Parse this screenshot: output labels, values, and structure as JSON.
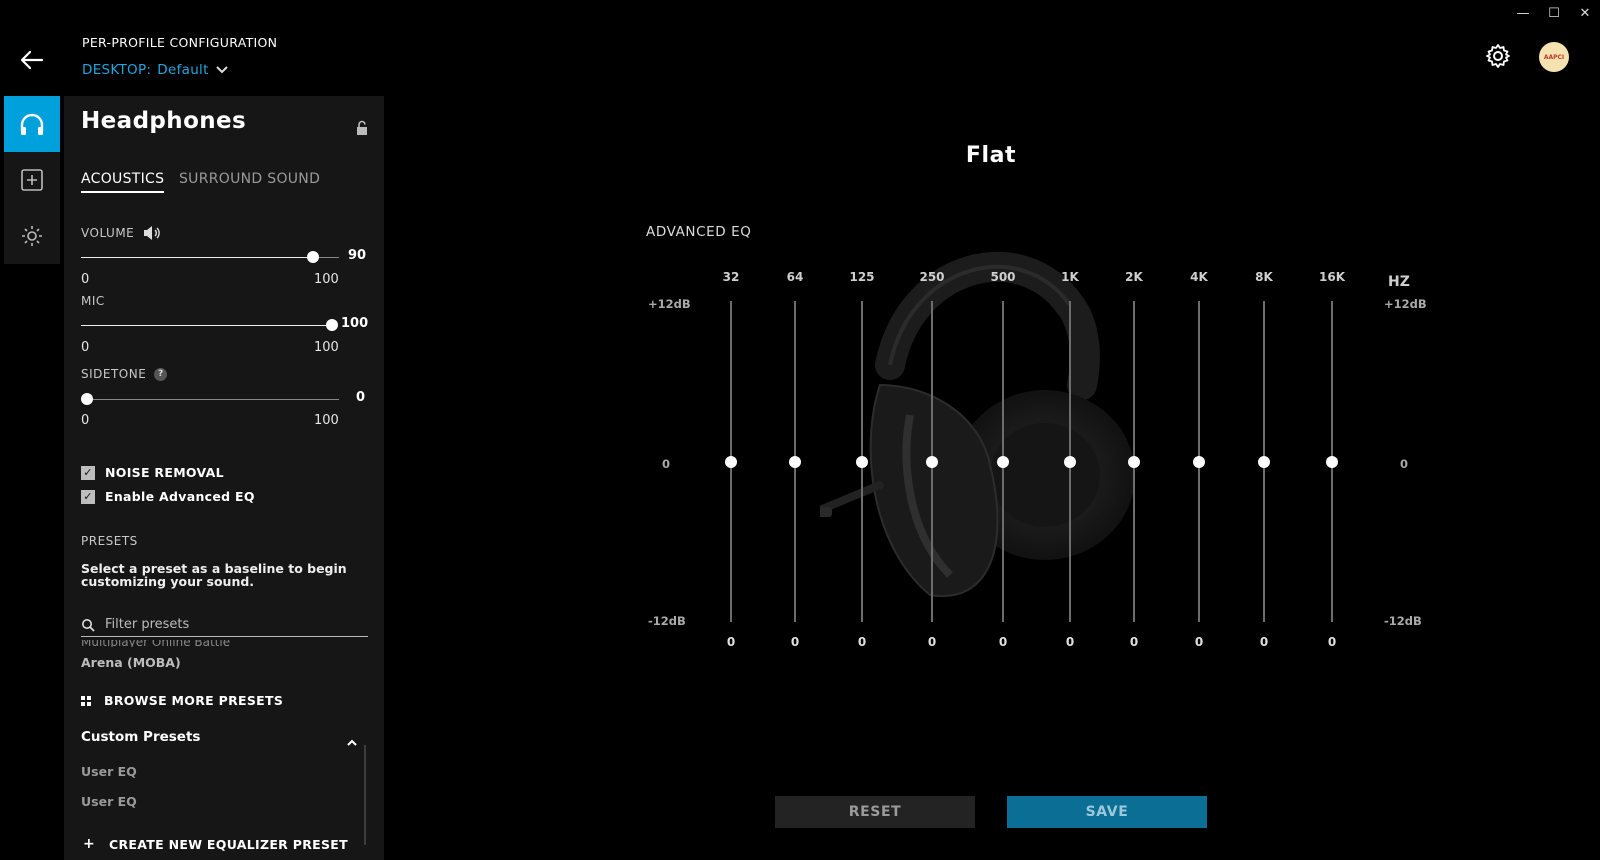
{
  "window": {
    "controls": [
      {
        "name": "minimize",
        "glyph": "—"
      },
      {
        "name": "maximize",
        "glyph": "☐"
      },
      {
        "name": "close",
        "glyph": "✕"
      }
    ]
  },
  "header": {
    "title": "PER-PROFILE CONFIGURATION",
    "profile_prefix": "DESKTOP:",
    "profile_name": "Default",
    "avatar_text": "AAPCI"
  },
  "rail": {
    "items": [
      {
        "icon": "headphones-icon",
        "active": true
      },
      {
        "icon": "add-box-icon",
        "active": false
      },
      {
        "icon": "lightsync-icon",
        "active": false
      }
    ]
  },
  "panel": {
    "title": "Headphones",
    "tabs": [
      "ACOUSTICS",
      "SURROUND SOUND"
    ],
    "active_tab": "ACOUSTICS",
    "volume": {
      "label": "VOLUME",
      "value": "90",
      "level": 0.9,
      "min": "0",
      "max": "100"
    },
    "mic": {
      "label": "MIC",
      "value": "100",
      "level": 1.0,
      "min": "0",
      "max": "100"
    },
    "sidetone": {
      "label": "SIDETONE",
      "value": "0",
      "level": 0.0,
      "min": "0",
      "max": "100",
      "help": "?"
    },
    "noise_removal": {
      "label": "NOISE REMOVAL",
      "checked": true
    },
    "advanced_eq": {
      "label": "Enable Advanced EQ",
      "checked": true
    },
    "presets": {
      "label": "PRESETS",
      "description": "Select a preset as a baseline to begin customizing your sound.",
      "filter_placeholder": "Filter presets",
      "cut_item": "Multiplayer Online Battle",
      "item": "Arena (MOBA)",
      "browse_label": "BROWSE MORE PRESETS"
    },
    "custom_presets": {
      "title": "Custom Presets",
      "items": [
        "User EQ",
        "User EQ"
      ],
      "create_label": "CREATE NEW EQUALIZER PRESET"
    }
  },
  "eq": {
    "preset_title": "Flat",
    "section_label": "ADVANCED EQ",
    "hz_label": "HZ",
    "db_top": "+12dB",
    "db_mid": "0",
    "db_bottom": "-12dB",
    "bands": [
      {
        "freq": "32",
        "value": "0",
        "gain": 0
      },
      {
        "freq": "64",
        "value": "0",
        "gain": 0
      },
      {
        "freq": "125",
        "value": "0",
        "gain": 0
      },
      {
        "freq": "250",
        "value": "0",
        "gain": 0
      },
      {
        "freq": "500",
        "value": "0",
        "gain": 0
      },
      {
        "freq": "1K",
        "value": "0",
        "gain": 0
      },
      {
        "freq": "2K",
        "value": "0",
        "gain": 0
      },
      {
        "freq": "4K",
        "value": "0",
        "gain": 0
      },
      {
        "freq": "8K",
        "value": "0",
        "gain": 0
      },
      {
        "freq": "16K",
        "value": "0",
        "gain": 0
      }
    ],
    "gain_range": [
      -12,
      12
    ]
  },
  "actions": {
    "reset_label": "RESET",
    "save_label": "SAVE"
  },
  "colors": {
    "accent": "#00a0dc",
    "save_bg": "#0b6e94",
    "panel_bg": "#161616"
  }
}
